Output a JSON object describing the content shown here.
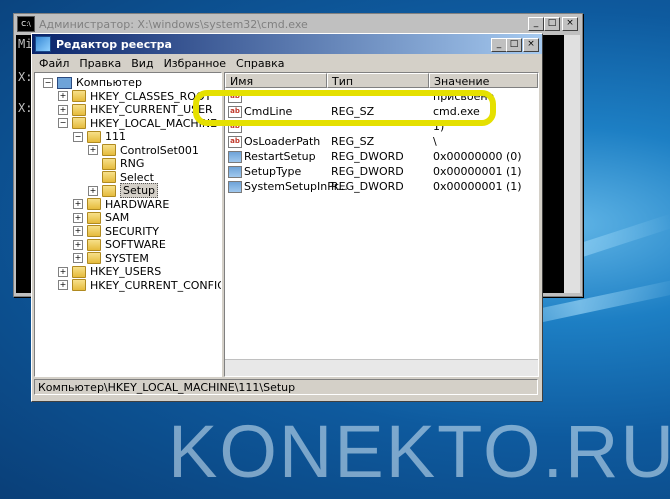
{
  "cmd": {
    "title": "Администратор: X:\\windows\\system32\\cmd.exe",
    "lines": [
      "Mi",
      "X:",
      "X:"
    ]
  },
  "regedit": {
    "title": "Редактор реестра",
    "menu": [
      "Файл",
      "Правка",
      "Вид",
      "Избранное",
      "Справка"
    ],
    "tree": [
      {
        "label": "Компьютер",
        "level": 0,
        "sign": "−",
        "icon": "computer"
      },
      {
        "label": "HKEY_CLASSES_ROOT",
        "level": 1,
        "sign": "+"
      },
      {
        "label": "HKEY_CURRENT_USER",
        "level": 1,
        "sign": "+"
      },
      {
        "label": "HKEY_LOCAL_MACHINE",
        "level": 1,
        "sign": "−"
      },
      {
        "label": "111",
        "level": 2,
        "sign": "−"
      },
      {
        "label": "ControlSet001",
        "level": 3,
        "sign": "+"
      },
      {
        "label": "RNG",
        "level": 3,
        "sign": ""
      },
      {
        "label": "Select",
        "level": 3,
        "sign": ""
      },
      {
        "label": "Setup",
        "level": 3,
        "sign": "+",
        "selected": true
      },
      {
        "label": "HARDWARE",
        "level": 2,
        "sign": "+"
      },
      {
        "label": "SAM",
        "level": 2,
        "sign": "+"
      },
      {
        "label": "SECURITY",
        "level": 2,
        "sign": "+"
      },
      {
        "label": "SOFTWARE",
        "level": 2,
        "sign": "+"
      },
      {
        "label": "SYSTEM",
        "level": 2,
        "sign": "+"
      },
      {
        "label": "HKEY_USERS",
        "level": 1,
        "sign": "+"
      },
      {
        "label": "HKEY_CURRENT_CONFIG",
        "level": 1,
        "sign": "+"
      }
    ],
    "columns": [
      "Имя",
      "Тип",
      "Значение"
    ],
    "values": [
      {
        "name": "",
        "type": "",
        "data": "присвоено",
        "icon": "ab"
      },
      {
        "name": "CmdLine",
        "type": "REG_SZ",
        "data": "cmd.exe",
        "icon": "ab"
      },
      {
        "name": "",
        "type": "",
        "data": "1)",
        "icon": "ab"
      },
      {
        "name": "OsLoaderPath",
        "type": "REG_SZ",
        "data": "\\",
        "icon": "ab"
      },
      {
        "name": "RestartSetup",
        "type": "REG_DWORD",
        "data": "0x00000000 (0)",
        "icon": "dw"
      },
      {
        "name": "SetupType",
        "type": "REG_DWORD",
        "data": "0x00000001 (1)",
        "icon": "dw"
      },
      {
        "name": "SystemSetupInPr...",
        "type": "REG_DWORD",
        "data": "0x00000001 (1)",
        "icon": "dw"
      }
    ],
    "status": "Компьютер\\HKEY_LOCAL_MACHINE\\111\\Setup"
  },
  "watermark": "KONEKTO.RU",
  "colors": {
    "highlight": "#e5e000",
    "titlebar": "#0a246a"
  }
}
